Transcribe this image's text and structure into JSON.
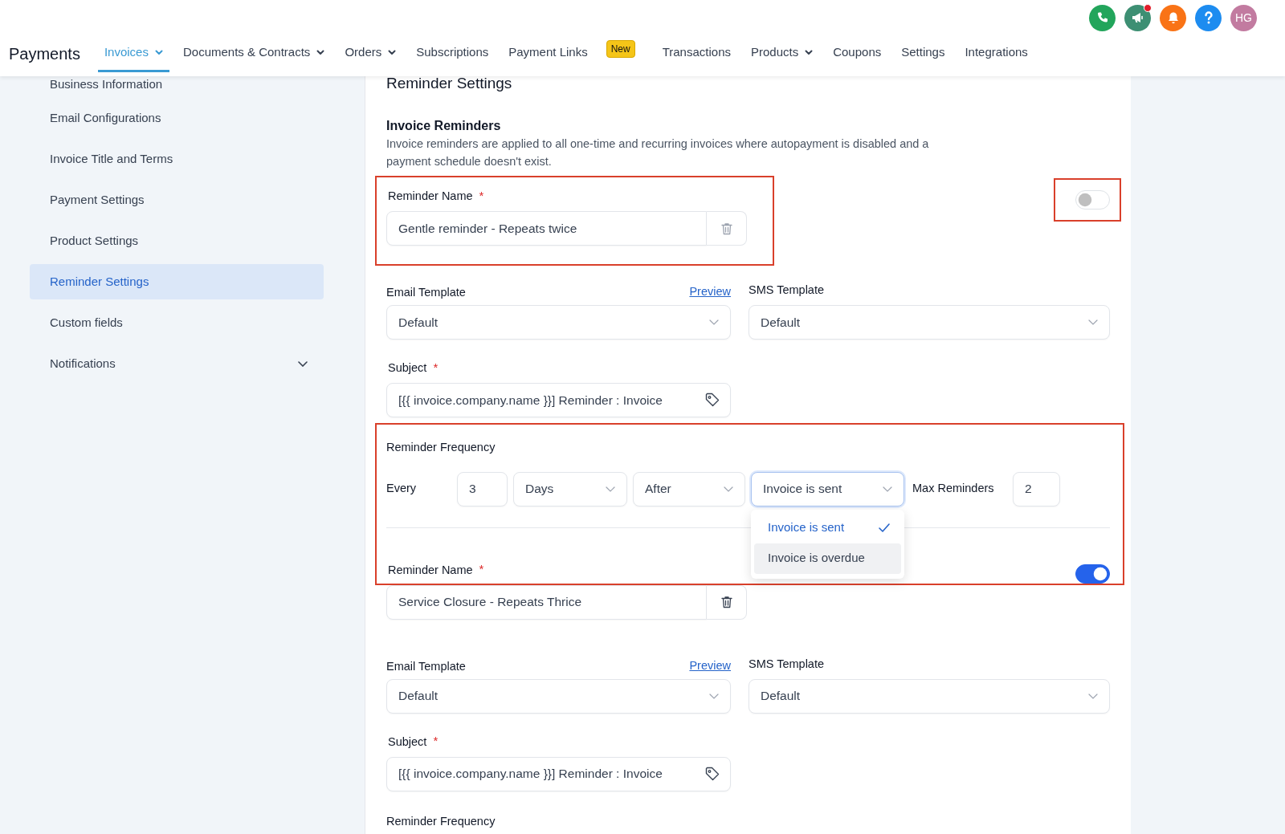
{
  "header": {
    "title": "Payments",
    "nav": [
      {
        "label": "Invoices",
        "selected": true,
        "has_menu": true
      },
      {
        "label": "Documents & Contracts",
        "selected": false,
        "has_menu": true
      },
      {
        "label": "Orders",
        "selected": false,
        "has_menu": true
      },
      {
        "label": "Subscriptions",
        "selected": false,
        "has_menu": false
      },
      {
        "label": "Payment Links",
        "selected": false,
        "has_menu": false,
        "badge": "New"
      },
      {
        "label": "Transactions",
        "selected": false,
        "has_menu": false
      },
      {
        "label": "Products",
        "selected": false,
        "has_menu": true
      },
      {
        "label": "Coupons",
        "selected": false,
        "has_menu": false
      },
      {
        "label": "Settings",
        "selected": false,
        "has_menu": false
      },
      {
        "label": "Integrations",
        "selected": false,
        "has_menu": false
      }
    ],
    "actions": [
      {
        "kind": "phone",
        "color": "#22a55b",
        "notification": false
      },
      {
        "kind": "megaphone",
        "color": "#3d8f73",
        "notification": true
      },
      {
        "kind": "bell",
        "color": "#f97316",
        "notification": false
      },
      {
        "kind": "help",
        "color": "#1d8cf0",
        "notification": false
      },
      {
        "kind": "avatar",
        "color": "#c27ba0",
        "notification": false,
        "initials": "HG"
      }
    ]
  },
  "sidebar": {
    "items": [
      {
        "label": "Business Information",
        "selected": false,
        "expandable": false
      },
      {
        "label": "Email Configurations",
        "selected": false,
        "expandable": false
      },
      {
        "label": "Invoice Title and Terms",
        "selected": false,
        "expandable": false
      },
      {
        "label": "Payment Settings",
        "selected": false,
        "expandable": false
      },
      {
        "label": "Product Settings",
        "selected": false,
        "expandable": false
      },
      {
        "label": "Reminder Settings",
        "selected": true,
        "expandable": false
      },
      {
        "label": "Custom fields",
        "selected": false,
        "expandable": false
      },
      {
        "label": "Notifications",
        "selected": false,
        "expandable": true
      }
    ]
  },
  "page": {
    "title": "Reminder Settings",
    "section": {
      "title": "Invoice Reminders",
      "description": "Invoice reminders are applied to all one-time and recurring invoices where autopayment is disabled and a payment schedule doesn't exist."
    },
    "reminders": [
      {
        "name_label": "Reminder Name",
        "name_required_mark": "*",
        "name": "Gentle reminder - Repeats twice",
        "enabled": false,
        "highlight_name": true,
        "highlight_toggle": true,
        "email_template_label": "Email Template",
        "preview_link": "Preview",
        "email_template": "Default",
        "sms_template_label": "SMS Template",
        "sms_template": "Default",
        "subject_label": "Subject",
        "subject_required_mark": "*",
        "subject": "[{{ invoice.company.name }}] Reminder : Invoice",
        "frequency_label": "Reminder Frequency",
        "highlight_frequency": true,
        "frequency": {
          "every_label": "Every",
          "count": "3",
          "unit": "Days",
          "relation": "After",
          "event": "Invoice is sent",
          "event_open": true,
          "event_options": [
            {
              "label": "Invoice is sent",
              "selected": true,
              "hovered": false
            },
            {
              "label": "Invoice is overdue",
              "selected": false,
              "hovered": true
            }
          ],
          "max_label": "Max Reminders",
          "max": "2"
        }
      },
      {
        "name_label": "Reminder Name",
        "name_required_mark": "*",
        "name": "Service Closure - Repeats Thrice",
        "enabled": true,
        "highlight_name": false,
        "highlight_toggle": false,
        "email_template_label": "Email Template",
        "preview_link": "Preview",
        "email_template": "Default",
        "sms_template_label": "SMS Template",
        "sms_template": "Default",
        "subject_label": "Subject",
        "subject_required_mark": "*",
        "subject": "[{{ invoice.company.name }}] Reminder : Invoice",
        "frequency_label": "Reminder Frequency",
        "highlight_frequency": false
      }
    ]
  }
}
